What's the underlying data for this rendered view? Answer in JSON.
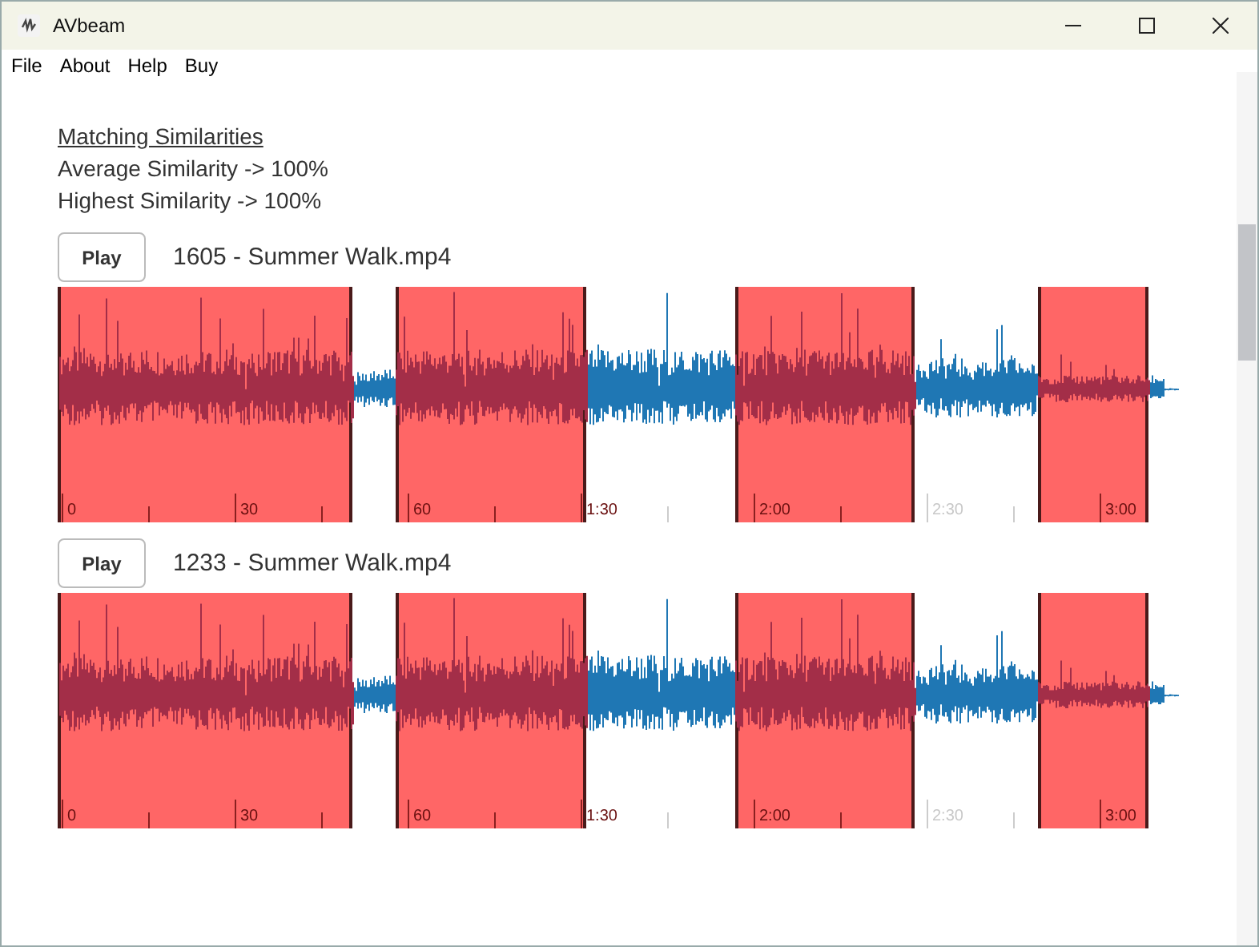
{
  "window": {
    "title": "AVbeam"
  },
  "menu": [
    "File",
    "About",
    "Help",
    "Buy"
  ],
  "summary": {
    "heading": "Matching Similarities",
    "lines": [
      "Average Similarity -> 100%",
      "Highest Similarity -> 100%"
    ]
  },
  "tracks": [
    {
      "button": "Play",
      "file": "1605 - Summer Walk.mp4",
      "time_labels": [
        "0",
        "30",
        "60",
        "1:30",
        "2:00",
        "2:30",
        "3:00"
      ]
    },
    {
      "button": "Play",
      "file": "1233 - Summer Walk.mp4",
      "time_labels": [
        "0",
        "30",
        "60",
        "1:30",
        "2:00",
        "2:30",
        "3:00"
      ]
    }
  ]
}
